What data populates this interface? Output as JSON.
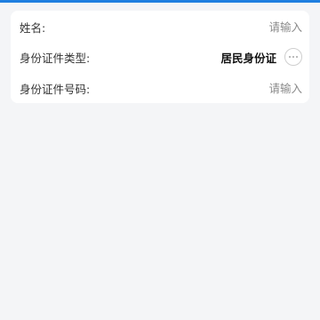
{
  "form": {
    "name": {
      "label": "姓名:",
      "placeholder": "请输入",
      "value": ""
    },
    "id_type": {
      "label": "身份证件类型:",
      "value": "居民身份证",
      "icon": "more-dots-icon"
    },
    "id_number": {
      "label": "身份证件号码:",
      "placeholder": "请输入",
      "value": ""
    }
  },
  "colors": {
    "accent": "#1f7fe0",
    "background": "#f4f5f7",
    "card": "#ffffff",
    "placeholder": "#8a8a8a"
  }
}
